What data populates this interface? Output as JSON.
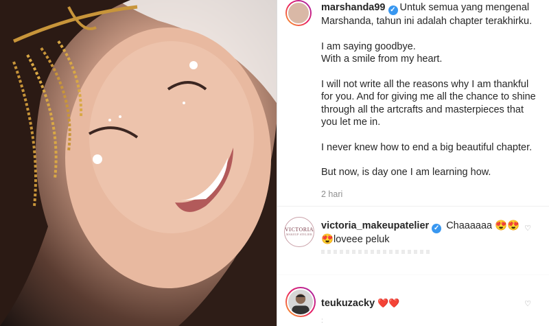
{
  "post": {
    "username": "marshanda99",
    "verified_icon": "verified-badge-icon",
    "paragraphs": [
      "Untuk semua yang mengenal Marshanda, tahun ini adalah chapter terakhirku.",
      "I am saying goodbye.\nWith a smile from my heart.",
      "I will not write all the reasons why I am thankful for you. And for giving me all the chance to shine through all the artcrafts and masterpieces that you let me in.",
      "I never knew how to end a big beautiful chapter.",
      "But now, is day one I am learning how."
    ],
    "time": "2 hari"
  },
  "comments": [
    {
      "username": "victoria_makeupatelier",
      "text_line1": "Chaaaaaa 😍😍",
      "text_line2": "😍loveee peluk",
      "logo_text": "VICTORIA",
      "logo_sub": "MAKEUP ATELIER"
    },
    {
      "username": "teukuzacky",
      "text": "❤️❤️"
    }
  ],
  "colors": {
    "verified": "#3897f0",
    "heart": "#ed4956",
    "muted": "#8e8e8e"
  }
}
